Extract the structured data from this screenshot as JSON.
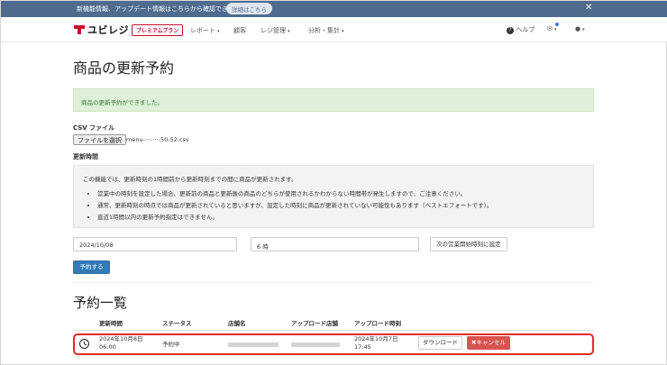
{
  "announcement": {
    "message": "新機能情報、アップデート情報はこちらから確認できます。",
    "detail_link": "詳細はこちら",
    "close_glyph": "✕"
  },
  "nav": {
    "logo_text": "ユビレジ",
    "plan_badge": "プレミアムプラン",
    "menu": [
      {
        "label": "レポート",
        "caret": "▾"
      },
      {
        "label": "顧客",
        "caret": ""
      },
      {
        "label": "レジ管理",
        "caret": "▾"
      },
      {
        "label": "分析・集計",
        "caret": "▾"
      }
    ],
    "help": "ヘルプ",
    "help_icon": "?",
    "mail_caret": "▾",
    "user_caret": "▾"
  },
  "page": {
    "title": "商品の更新予約",
    "success_message": "商品の更新予約ができました。",
    "csv_label": "CSV ファイル",
    "file_button": "ファイルを選択",
    "file_name": "menu-···-···-50-52.csv",
    "update_time_label": "更新時間",
    "info_lead": "この機能では、更新時刻の1時間前から更新時刻までの間に商品が更新されます。",
    "info_bullets": [
      "営業中の時刻を設定した場合、更新前の商品と更新後の商品のどちらが使用されるかわからない時間帯が発生しますので、ご注意ください。",
      "通常、更新時刻の時点では商品が更新されていると思いますが、設定した時刻に商品が更新されていない可能性もあります（ベストエフォートです）。",
      "直近1時間以内の更新予約指定はできません。"
    ],
    "date_value": "2024/10/08",
    "hour_value": "6 時",
    "select_chevron": "⌄",
    "next_open_button": "次の営業開始時刻に設定",
    "reserve_button": "予約する"
  },
  "reservations": {
    "title": "予約一覧",
    "headers": [
      "更新時間",
      "ステータス",
      "店舗名",
      "アップロード店舗",
      "アップロード時刻"
    ],
    "rows": [
      {
        "update_time_line1": "2024年10月8日",
        "update_time_line2": "06:00",
        "status": "予約中",
        "upload_time_line1": "2024年10月7日",
        "upload_time_line2": "17:45",
        "download_label": "ダウンロード",
        "cancel_label": "✖キャンセル"
      }
    ]
  },
  "colors": {
    "announce_bar": "#4f6c8e",
    "brand_red": "#c8102e",
    "primary": "#337ab7",
    "danger": "#d9534f",
    "highlight": "#e32a1e"
  }
}
